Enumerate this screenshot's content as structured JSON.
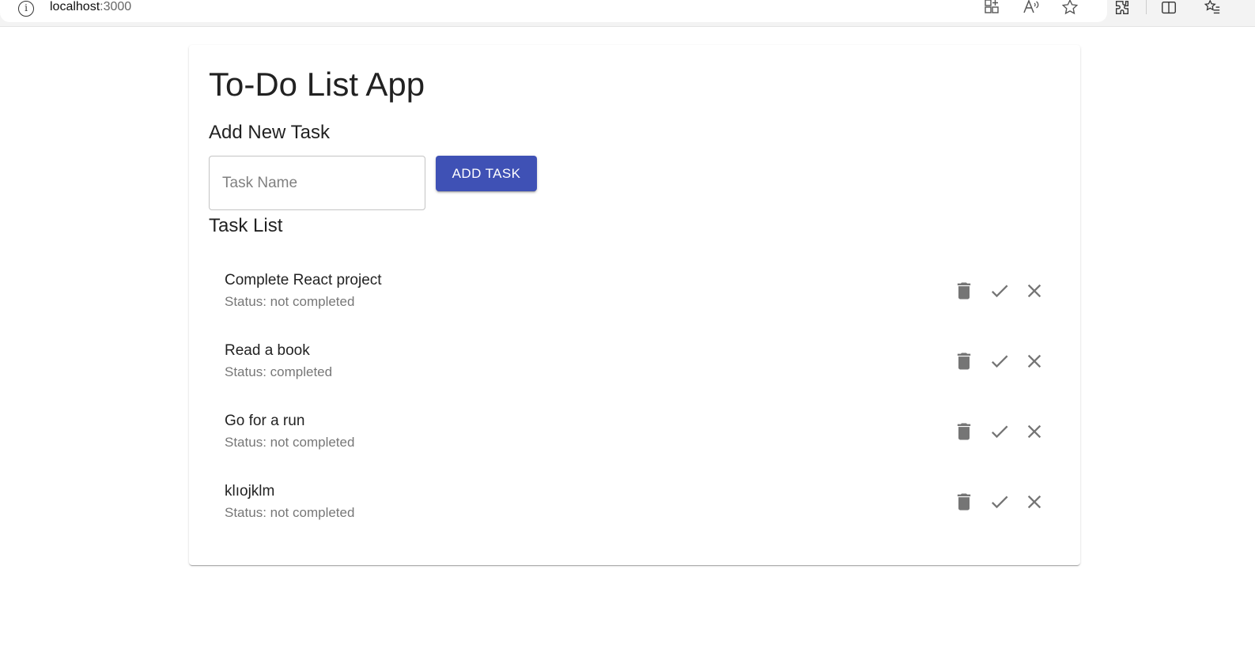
{
  "browser": {
    "url_host": "localhost",
    "url_port": ":3000"
  },
  "app": {
    "title": "To-Do List App",
    "add_section_title": "Add New Task",
    "input_placeholder": "Task Name",
    "add_button_label": "ADD TASK",
    "list_section_title": "Task List",
    "accent_color": "#3f51b5"
  },
  "tasks": [
    {
      "name": "Complete React project",
      "status": "Status: not completed"
    },
    {
      "name": "Read a book",
      "status": "Status: completed"
    },
    {
      "name": "Go for a run",
      "status": "Status: not completed"
    },
    {
      "name": "klıojklm",
      "status": "Status: not completed"
    }
  ],
  "icons": {
    "delete": "delete-icon",
    "complete": "check-icon",
    "uncomplete": "close-icon"
  }
}
